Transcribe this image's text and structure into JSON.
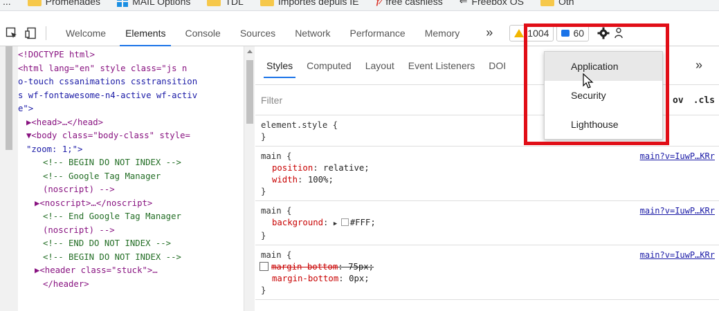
{
  "bookmarks": [
    {
      "label": "...",
      "icon": "text"
    },
    {
      "label": "Promenades",
      "icon": "folder-icon"
    },
    {
      "label": "MAIL Options",
      "icon": "windows-logo-icon"
    },
    {
      "label": "TDL",
      "icon": "folder-icon"
    },
    {
      "label": "Importés depuis IE",
      "icon": "folder-icon"
    },
    {
      "label": "free cashless",
      "icon": "pdf-icon"
    },
    {
      "label": "Freebox OS",
      "icon": "arrow-icon"
    },
    {
      "label": "Oth",
      "icon": "folder-icon"
    }
  ],
  "toolbar": {
    "tabs": [
      "Welcome",
      "Elements",
      "Console",
      "Sources",
      "Network",
      "Performance",
      "Memory"
    ],
    "active_tab": "Elements",
    "more_label": "»",
    "warning_count": "1004",
    "message_count": "60"
  },
  "elements_tree": [
    {
      "indent": 0,
      "text": "<!DOCTYPE html>"
    },
    {
      "indent": 0,
      "text": "<html lang=\"en\" style class=\"js n"
    },
    {
      "indent": 0,
      "text": "o-touch cssanimations csstransition"
    },
    {
      "indent": 0,
      "text": "s wf-fontawesome-n4-active wf-activ"
    },
    {
      "indent": 0,
      "text": "e\">"
    },
    {
      "indent": 1,
      "text": "▶<head>…</head>"
    },
    {
      "indent": 1,
      "text": "▼<body class=\"body-class\" style="
    },
    {
      "indent": 1,
      "text": "\"zoom: 1;\">"
    },
    {
      "indent": 3,
      "text": "<!-- BEGIN DO NOT INDEX -->"
    },
    {
      "indent": 3,
      "text": "<!-- Google Tag Manager"
    },
    {
      "indent": 3,
      "text": "(noscript) -->"
    },
    {
      "indent": 2,
      "text": "▶<noscript>…</noscript>"
    },
    {
      "indent": 3,
      "text": "<!-- End Google Tag Manager"
    },
    {
      "indent": 3,
      "text": "(noscript) -->"
    },
    {
      "indent": 3,
      "text": "<!-- END DO NOT INDEX -->"
    },
    {
      "indent": 3,
      "text": "<!-- BEGIN DO NOT INDEX -->"
    },
    {
      "indent": 2,
      "text": "▶<header class=\"stuck\">…"
    },
    {
      "indent": 3,
      "text": "</header>"
    }
  ],
  "styles_pane": {
    "tabs": [
      "Styles",
      "Computed",
      "Layout",
      "Event Listeners",
      "DOI"
    ],
    "active_tab": "Styles",
    "more_label": "»",
    "filter_placeholder": "Filter",
    "filter_right_1": "ov",
    "filter_right_2": ".cls",
    "rules": [
      {
        "selector": "element.style {",
        "source": "",
        "props": []
      },
      {
        "selector": "main {",
        "source": "main?v=IuwP…KRr",
        "props": [
          {
            "name": "position",
            "value": "relative;",
            "struck": false,
            "checkbox": false
          },
          {
            "name": "width",
            "value": "100%;",
            "struck": false,
            "checkbox": false
          }
        ]
      },
      {
        "selector": "main {",
        "source": "main?v=IuwP…KRr",
        "props": [
          {
            "name": "background",
            "value": "#FFF;",
            "struck": false,
            "checkbox": false,
            "swatch": true
          }
        ]
      },
      {
        "selector": "main {",
        "source": "main?v=IuwP…KRr",
        "props": [
          {
            "name": "margin-bottom",
            "value": "75px;",
            "struck": true,
            "checkbox": true
          },
          {
            "name": "margin-bottom",
            "value": "0px;",
            "struck": false,
            "checkbox": false
          }
        ]
      }
    ],
    "closing_brace": "}"
  },
  "dropdown": {
    "items": [
      "Application",
      "Security",
      "Lighthouse"
    ],
    "hovered": "Application"
  },
  "colors": {
    "highlight": "#e10e17",
    "accent": "#1a73e8",
    "warning": "#f2b600"
  }
}
